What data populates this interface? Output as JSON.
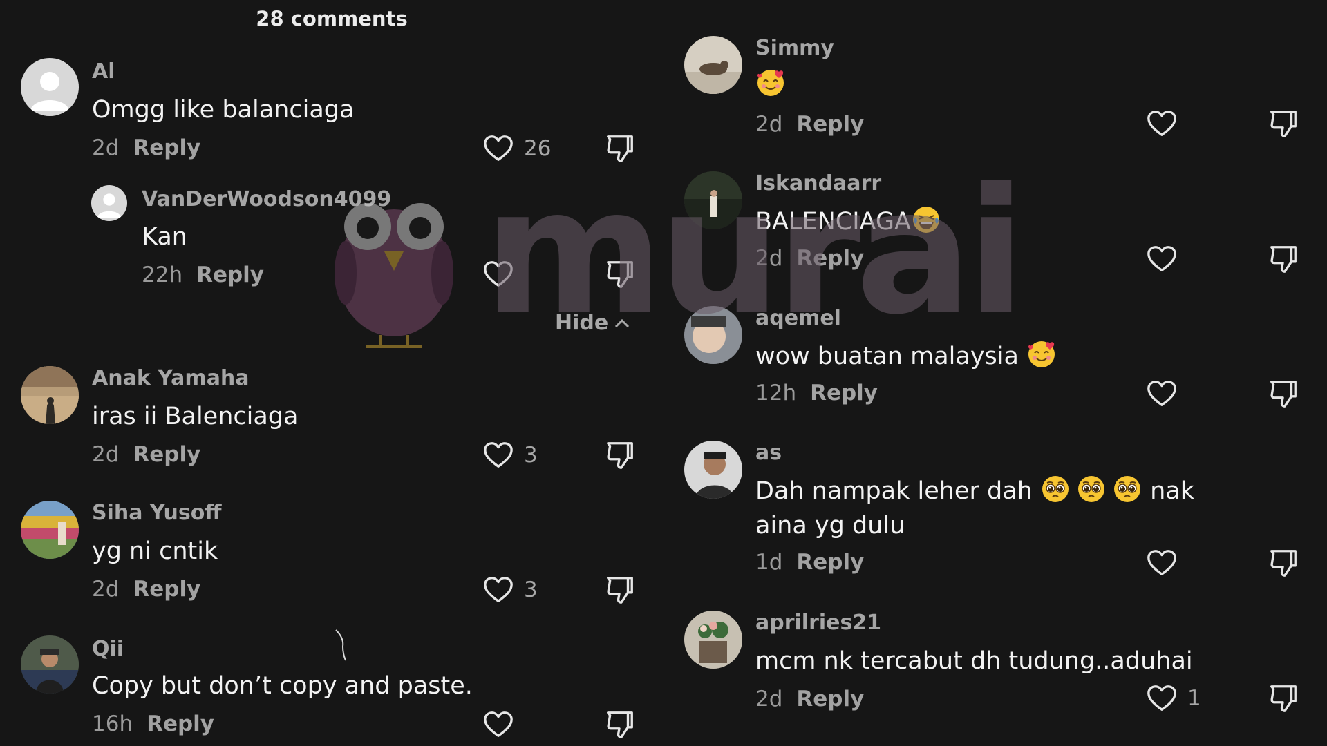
{
  "header": {
    "title": "28 comments"
  },
  "hide_label": "Hide",
  "watermark": {
    "text": "murai"
  },
  "left_comments": [
    {
      "username": "Al",
      "text": "Omgg like balanciaga",
      "age": "2d",
      "reply": "Reply",
      "likes": "26"
    },
    {
      "username": "VanDerWoodson4099",
      "text": "Kan",
      "age": "22h",
      "reply": "Reply",
      "likes": ""
    },
    {
      "username": "Anak Yamaha",
      "text": "iras ii Balenciaga",
      "age": "2d",
      "reply": "Reply",
      "likes": "3"
    },
    {
      "username": "Siha Yusoff",
      "text": "yg ni cntik",
      "age": "2d",
      "reply": "Reply",
      "likes": "3"
    },
    {
      "username": "Qii",
      "text": "Copy but don’t copy and paste.",
      "age": "16h",
      "reply": "Reply",
      "likes": ""
    }
  ],
  "right_comments": [
    {
      "username": "Simmy",
      "text": "",
      "age": "2d",
      "reply": "Reply",
      "likes": ""
    },
    {
      "username": "Iskandaarr",
      "text": "BALENCIAGA",
      "age": "2d",
      "reply": "Reply",
      "likes": ""
    },
    {
      "username": "aqemel",
      "text": "wow buatan malaysia ",
      "age": "12h",
      "reply": "Reply",
      "likes": ""
    },
    {
      "username": "as",
      "text_line1": "Dah nampak leher dah ",
      "text_mid": " nak",
      "text_line2": "aina yg dulu",
      "age": "1d",
      "reply": "Reply",
      "likes": ""
    },
    {
      "username": "aprilries21",
      "text": "mcm nk tercabut dh tudung..aduhai",
      "age": "2d",
      "reply": "Reply",
      "likes": "1"
    }
  ],
  "icons": {
    "like": "heart-outline-icon",
    "dislike": "thumbs-down-icon",
    "hide": "chevron-up-icon"
  },
  "colors": {
    "background": "#161616",
    "username": "#a6a6a6",
    "text": "#f2f2f2",
    "meta": "#9a9a9a"
  }
}
